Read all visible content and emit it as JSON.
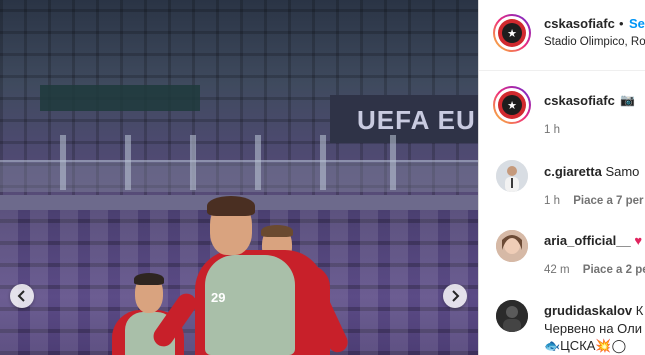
{
  "post": {
    "image_alt": "CSKA Sofia players training at Stadio Olimpico",
    "board_text": "UEFA EU",
    "shirt_number": "29",
    "nav": {
      "prev_icon": "chevron-left-icon",
      "next_icon": "chevron-right-icon"
    }
  },
  "header": {
    "username": "cskasofiafc",
    "separator": "•",
    "follow_label": "Seg",
    "location": "Stadio Olimpico, Ro"
  },
  "caption": {
    "username": "cskasofiafc",
    "text": "📷",
    "time": "1 h"
  },
  "comments": [
    {
      "username": "c.giaretta",
      "text": "Samo",
      "time": "1 h",
      "likes": "Piace a 7 per"
    },
    {
      "username": "aria_official__",
      "text": "♥",
      "time": "42 m",
      "likes": "Piace a 2 pe"
    },
    {
      "username": "grudidaskalov",
      "text": "К",
      "line2": "Червено на Оли",
      "line3": "🐟ЦСКА💥◯"
    }
  ],
  "colors": {
    "accent": "#0095f6",
    "text": "#262626",
    "muted": "#737373",
    "club_red": "#c8202a"
  }
}
